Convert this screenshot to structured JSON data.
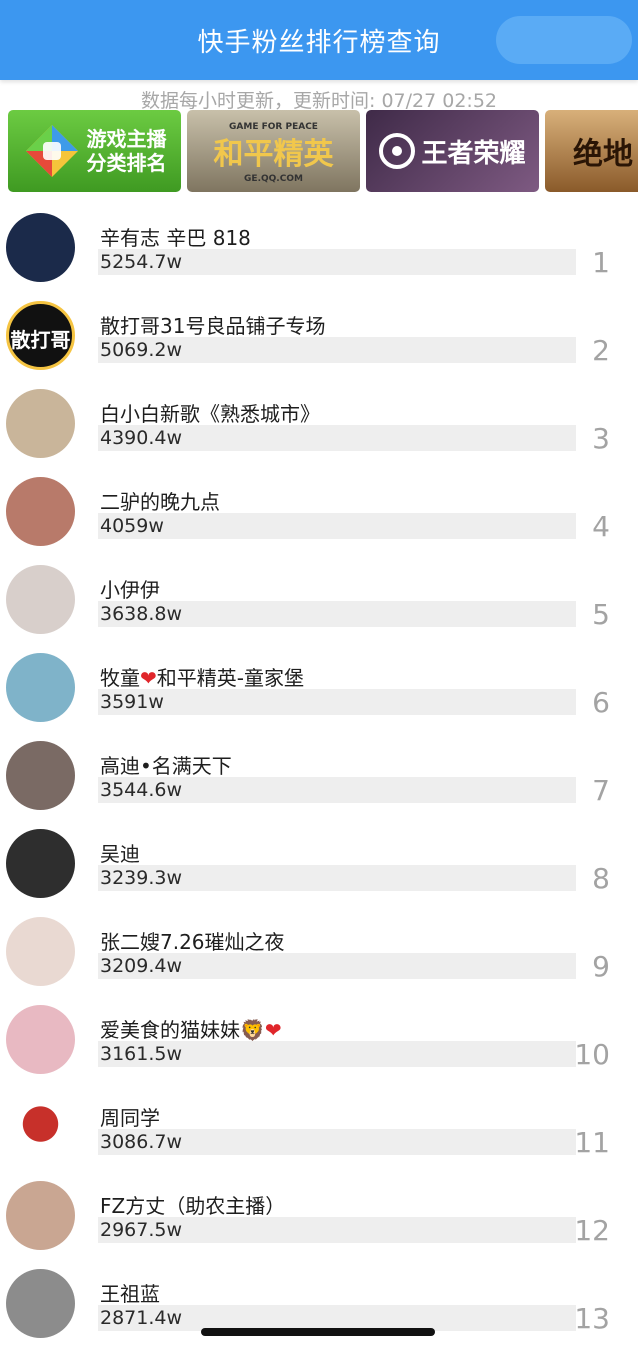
{
  "header": {
    "title": "快手粉丝排行榜查询"
  },
  "update_text": "数据每小时更新，更新时间: 07/27 02:52",
  "banners": [
    {
      "label_line1": "游戏主播",
      "label_line2": "分类排名",
      "icon": "gamepad-icon",
      "color": "#4fae2e"
    },
    {
      "label": "和平精英",
      "tagline": "GAME FOR PEACE",
      "domain_text": "GE.QQ.COM",
      "color": "#a39a82"
    },
    {
      "label": "王者荣耀",
      "icon": "honor-of-kings-emblem-icon",
      "color": "#5a3d62"
    },
    {
      "label": "绝地",
      "color": "#c08d58"
    }
  ],
  "rankings": [
    {
      "name": "辛有志 辛巴 818",
      "fans": "5254.7w",
      "rank": "1",
      "avatar_color": "#1b2a4a"
    },
    {
      "name": "散打哥31号良品铺子专场",
      "fans": "5069.2w",
      "rank": "2",
      "avatar_color": "#111111",
      "avatar_text": "散打哥"
    },
    {
      "name": "白小白新歌《熟悉城市》",
      "fans": "4390.4w",
      "rank": "3",
      "avatar_color": "#c9b59a"
    },
    {
      "name": "二驴的晚九点",
      "fans": "4059w",
      "rank": "4",
      "avatar_color": "#b87a6a"
    },
    {
      "name": "小伊伊",
      "fans": "3638.8w",
      "rank": "5",
      "avatar_color": "#d8cfcb"
    },
    {
      "name_before": "牧童",
      "name_heart": "❤",
      "name_after": "和平精英-童家堡",
      "fans": "3591w",
      "rank": "6",
      "avatar_color": "#7fb3c9"
    },
    {
      "name": "高迪•名满天下",
      "fans": "3544.6w",
      "rank": "7",
      "avatar_color": "#7a6a64"
    },
    {
      "name": "吴迪",
      "fans": "3239.3w",
      "rank": "8",
      "avatar_color": "#2e2e2e"
    },
    {
      "name": "张二嫂7.26璀灿之夜",
      "fans": "3209.4w",
      "rank": "9",
      "avatar_color": "#e9d9d2"
    },
    {
      "name_before": "爱美食的猫妹妹",
      "name_emoji": "🦁",
      "name_heart": "❤",
      "fans": "3161.5w",
      "rank": "10",
      "avatar_color": "#e8b9c2"
    },
    {
      "name": "周同学",
      "fans": "3086.7w",
      "rank": "11",
      "avatar_color": "#c7302a"
    },
    {
      "name": "FZ方丈（助农主播）",
      "fans": "2967.5w",
      "rank": "12",
      "avatar_color": "#c9a692"
    },
    {
      "name": "王祖蓝",
      "fans": "2871.4w",
      "rank": "13",
      "avatar_color": "#8c8c8c"
    }
  ]
}
